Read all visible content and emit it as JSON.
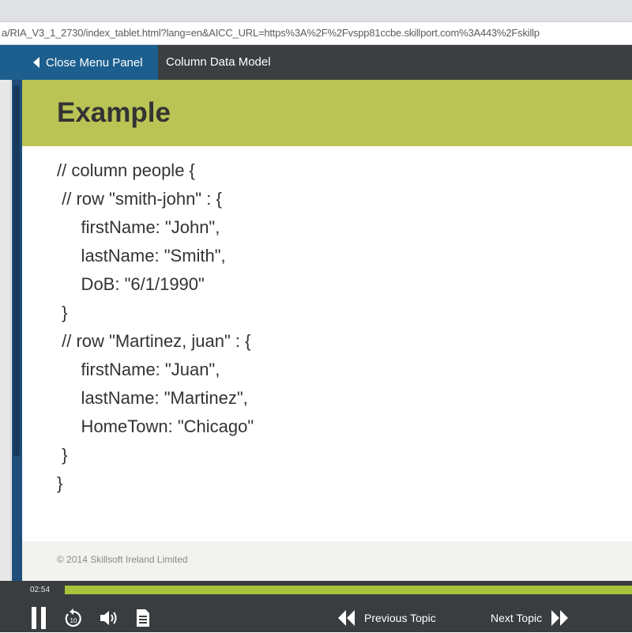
{
  "browser": {
    "url": "a/RIA_V3_1_2730/index_tablet.html?lang=en&AICC_URL=https%3A%2F%2Fvspp81ccbe.skillport.com%3A443%2Fskillp"
  },
  "header": {
    "close_menu_label": "Close Menu Panel",
    "course_title": "Column Data Model"
  },
  "slide": {
    "title": "Example",
    "code_lines": [
      "// column people {",
      " // row \"smith-john\" : {",
      "     firstName: \"John\",",
      "     lastName: \"Smith\",",
      "     DoB: \"6/1/1990\"",
      " }",
      " // row \"Martinez, juan\" : {",
      "     firstName: \"Juan\",",
      "     lastName: \"Martinez\",",
      "     HomeTown: \"Chicago\"",
      " }",
      "}"
    ],
    "copyright": "© 2014 Skillsoft Ireland Limited"
  },
  "player": {
    "elapsed_time": "02:54",
    "progress_fraction": 1.0,
    "previous_label": "Previous Topic",
    "next_label": "Next Topic",
    "icons": [
      "pause-icon",
      "replay-10-icon",
      "volume-icon",
      "transcript-icon",
      "rewind-icon",
      "fast-forward-icon"
    ]
  },
  "colors": {
    "accent_green": "#bac454",
    "progress_green": "#a6c33b",
    "menu_blue": "#1c5f8e",
    "toolbar_dark": "#3c3f41"
  }
}
